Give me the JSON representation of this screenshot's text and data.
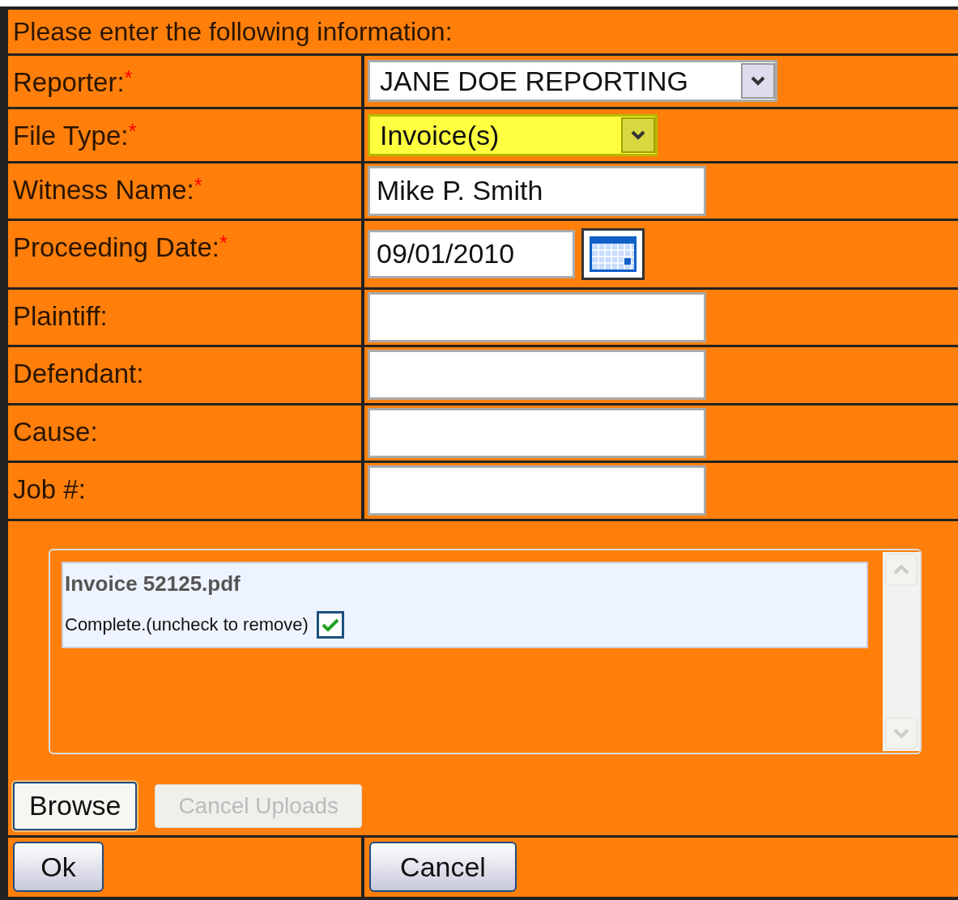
{
  "heading": "Please enter the following information:",
  "fields": [
    {
      "label": "Reporter:",
      "required_mark": "*",
      "kind": "select",
      "value": "JANE DOE REPORTING",
      "focused": false
    },
    {
      "label": "File Type:",
      "required_mark": "*",
      "kind": "select",
      "value": "Invoice(s)",
      "focused": true
    },
    {
      "label": "Witness Name:",
      "required_mark": "*",
      "kind": "text",
      "value": "Mike P. Smith",
      "focused": false
    },
    {
      "label": "Proceeding Date:",
      "required_mark": "*",
      "kind": "date",
      "value": "09/01/2010",
      "focused": false
    },
    {
      "label": "Plaintiff:",
      "kind": "text",
      "focused": false
    },
    {
      "label": "Defendant:",
      "kind": "text",
      "focused": false
    },
    {
      "label": "Cause:",
      "kind": "text",
      "focused": false
    },
    {
      "label": "Job #:",
      "kind": "text",
      "focused": false
    }
  ],
  "uploads": [
    {
      "file_name": "Invoice 52125.pdf",
      "status": "Complete.(uncheck to remove)",
      "checked": true
    }
  ],
  "upload_buttons": [
    {
      "label": "Browse",
      "disabled": false
    },
    {
      "label": "Cancel Uploads",
      "disabled": true
    }
  ],
  "ok_button": "Ok",
  "cancel_button": "Cancel"
}
